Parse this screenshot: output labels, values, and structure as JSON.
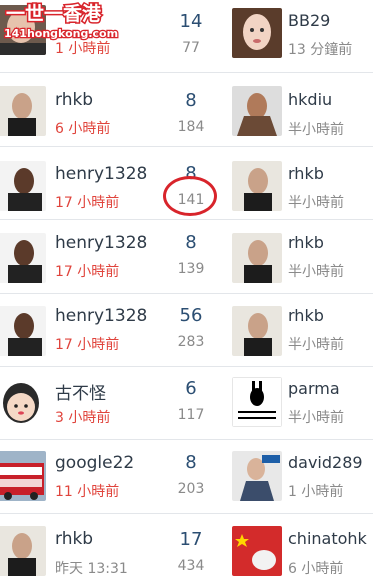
{
  "watermark": {
    "title": "一世一香港",
    "url": "141hongkong.com"
  },
  "rows": [
    {
      "name": "",
      "time": "1 小時前",
      "count_main": "14",
      "count_sub": "77",
      "last_name": "BB29",
      "last_time": "13 分鐘前"
    },
    {
      "name": "rhkb",
      "time": "6 小時前",
      "count_main": "8",
      "count_sub": "184",
      "last_name": "hkdiu",
      "last_time": "半小時前"
    },
    {
      "name": "henry1328",
      "time": "17 小時前",
      "count_main": "8",
      "count_sub": "141",
      "last_name": "rhkb",
      "last_time": "半小時前"
    },
    {
      "name": "henry1328",
      "time": "17 小時前",
      "count_main": "8",
      "count_sub": "139",
      "last_name": "rhkb",
      "last_time": "半小時前"
    },
    {
      "name": "henry1328",
      "time": "17 小時前",
      "count_main": "56",
      "count_sub": "283",
      "last_name": "rhkb",
      "last_time": "半小時前"
    },
    {
      "name": "古不怪",
      "time": "3 小時前",
      "count_main": "6",
      "count_sub": "117",
      "last_name": "parma",
      "last_time": "半小時前"
    },
    {
      "name": "google22",
      "time": "11 小時前",
      "count_main": "8",
      "count_sub": "203",
      "last_name": "david289",
      "last_time": "1 小時前"
    },
    {
      "name": "rhkb",
      "time": "昨天 13:31",
      "count_main": "17",
      "count_sub": "434",
      "last_name": "chinatohk",
      "last_time": "6 小時前"
    }
  ],
  "highlight": {
    "value": "141",
    "color": "#d8242b"
  },
  "colors": {
    "time_recent": "#e0443c",
    "count_main": "#2b4e72",
    "muted": "#8a8a8a",
    "name": "#2f3b48"
  }
}
